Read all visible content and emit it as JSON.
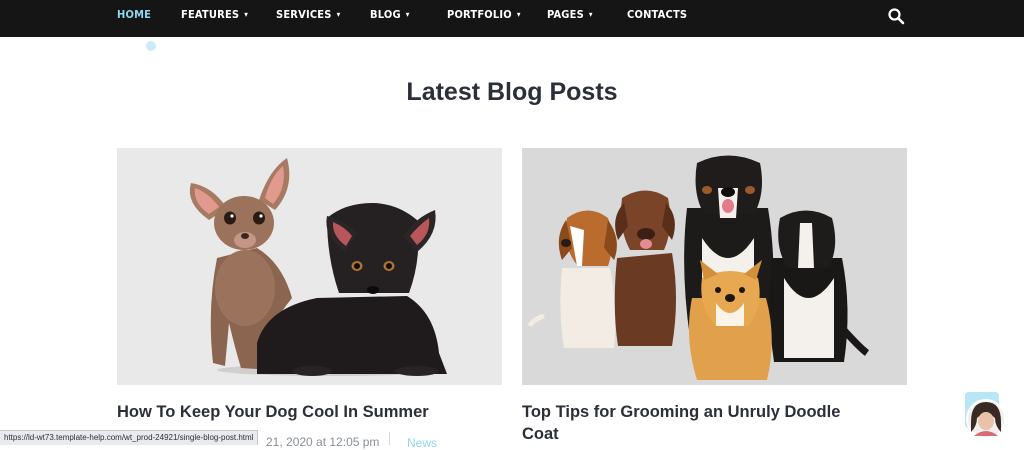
{
  "nav": {
    "items": [
      {
        "label": "HOME",
        "active": true,
        "has_dropdown": false
      },
      {
        "label": "FEATURES",
        "active": false,
        "has_dropdown": true
      },
      {
        "label": "SERVICES",
        "active": false,
        "has_dropdown": true
      },
      {
        "label": "BLOG",
        "active": false,
        "has_dropdown": true
      },
      {
        "label": "PORTFOLIO",
        "active": false,
        "has_dropdown": true
      },
      {
        "label": "PAGES",
        "active": false,
        "has_dropdown": true
      },
      {
        "label": "CONTACTS",
        "active": false,
        "has_dropdown": false
      }
    ],
    "search_icon": "search-icon",
    "dropdown_icon": "chevron-down-icon",
    "chevron_glyph": "▾"
  },
  "section": {
    "title": "Latest Blog Posts"
  },
  "posts": [
    {
      "title": "How To Keep Your Dog Cool In Summer",
      "date_visible": "21, 2020 at 12:05 pm",
      "category": "News",
      "image": "two-chihuahua-puppies"
    },
    {
      "title": "Top Tips for Grooming an Unruly Doodle Coat",
      "image": "group-of-five-dogs"
    }
  ],
  "status_bar": {
    "url": "https://ld-wt73.template-help.com/wt_prod-24921/single-blog-post.html"
  },
  "chat_widget": {
    "icon": "support-avatar-icon"
  },
  "colors": {
    "nav_bg": "#151515",
    "nav_active": "#8fd8f0",
    "heading": "#2b2f38",
    "meta": "#8a8f98",
    "accent": "#8fd8f0",
    "image_bg_1": "#e9e9e9",
    "image_bg_2": "#d9d9d9"
  }
}
